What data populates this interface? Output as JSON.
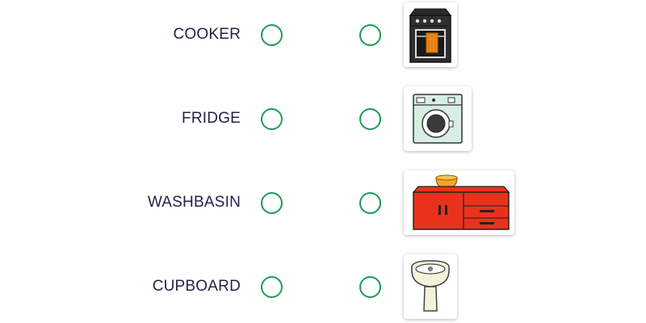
{
  "items": [
    {
      "word": "COOKER",
      "picture": "cooker-icon"
    },
    {
      "word": "FRIDGE",
      "picture": "washing-machine-icon"
    },
    {
      "word": "WASHBASIN",
      "picture": "kitchen-cupboard-icon"
    },
    {
      "word": "CUPBOARD",
      "picture": "washbasin-icon"
    }
  ],
  "colors": {
    "accent": "#1e9a55",
    "text": "#22224a"
  }
}
